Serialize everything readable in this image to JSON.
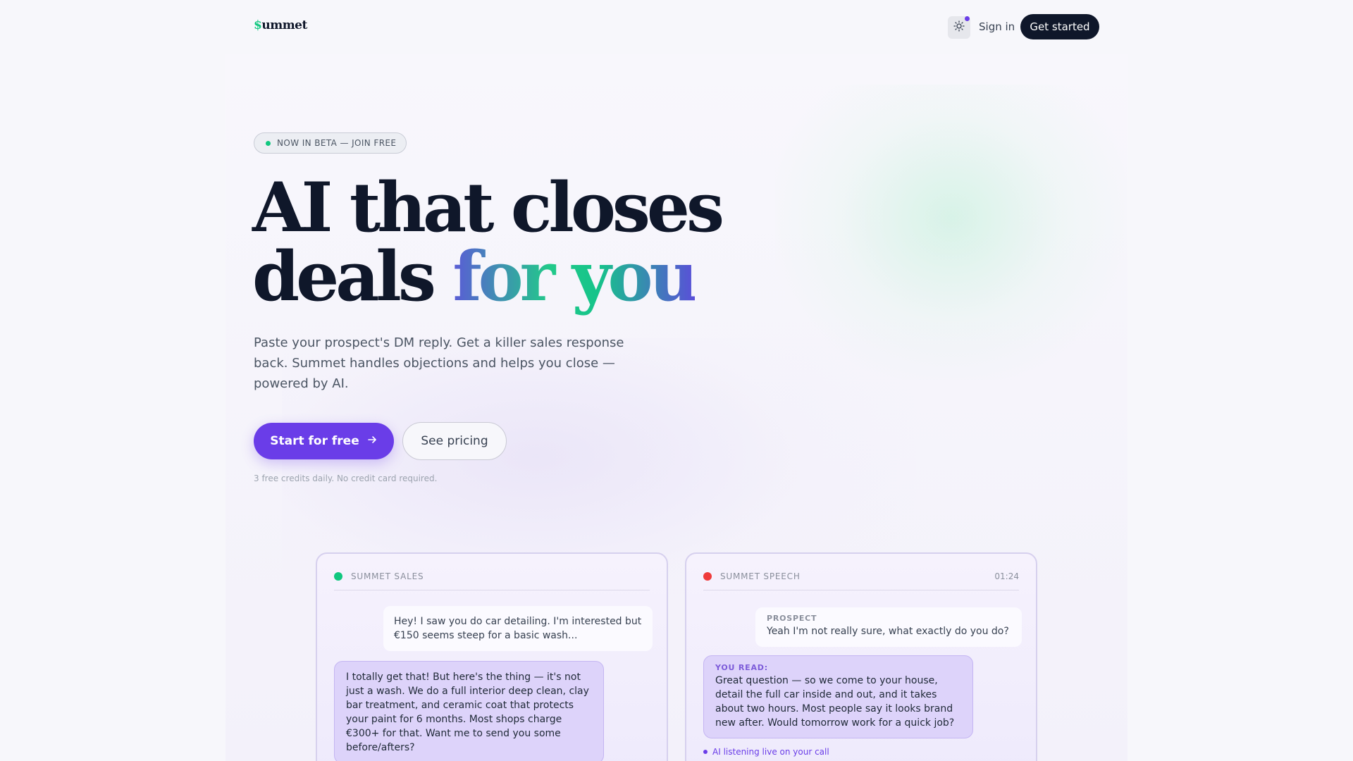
{
  "nav": {
    "logo_symbol": "$",
    "logo_text": "ummet",
    "sign_in": "Sign in",
    "get_started": "Get started",
    "theme_icon": "sun-icon",
    "accent": "#6a3de8"
  },
  "hero": {
    "badge": "NOW IN BETA — JOIN FREE",
    "headline_line1": "AI that closes",
    "headline_line2_plain": "deals",
    "headline_line2_gradient": "for you",
    "subcopy": "Paste your prospect's DM reply. Get a killer sales response back. Summet handles objections and helps you close — powered by AI.",
    "cta_primary": "Start for free",
    "cta_primary_icon": "arrow-right-icon",
    "cta_secondary": "See pricing",
    "fineprint": "3 free credits daily. No credit card required."
  },
  "cards": {
    "sales": {
      "title": "SUMMET SALES",
      "status_color": "#10c77f",
      "incoming": "Hey! I saw you do car detailing. I'm interested but €150 seems steep for a basic wash...",
      "reply": "I totally get that! But here's the thing — it's not just a wash. We do a full interior deep clean, clay bar treatment, and ceramic coat that protects your paint for 6 months. Most shops charge €300+ for that. Want me to send you some before/afters?"
    },
    "speech": {
      "title": "SUMMET SPEECH",
      "status_color": "#ef3b3b",
      "timer": "01:24",
      "prospect_tag": "PROSPECT",
      "prospect_text": "Yeah I'm not really sure, what exactly do you do?",
      "you_read_tag": "YOU READ:",
      "you_read_text": "Great question — so we come to your house, detail the full car inside and out, and it takes about two hours. Most people say it looks brand new after. Would tomorrow work for a quick job?",
      "listening": "AI listening live on your call"
    }
  }
}
